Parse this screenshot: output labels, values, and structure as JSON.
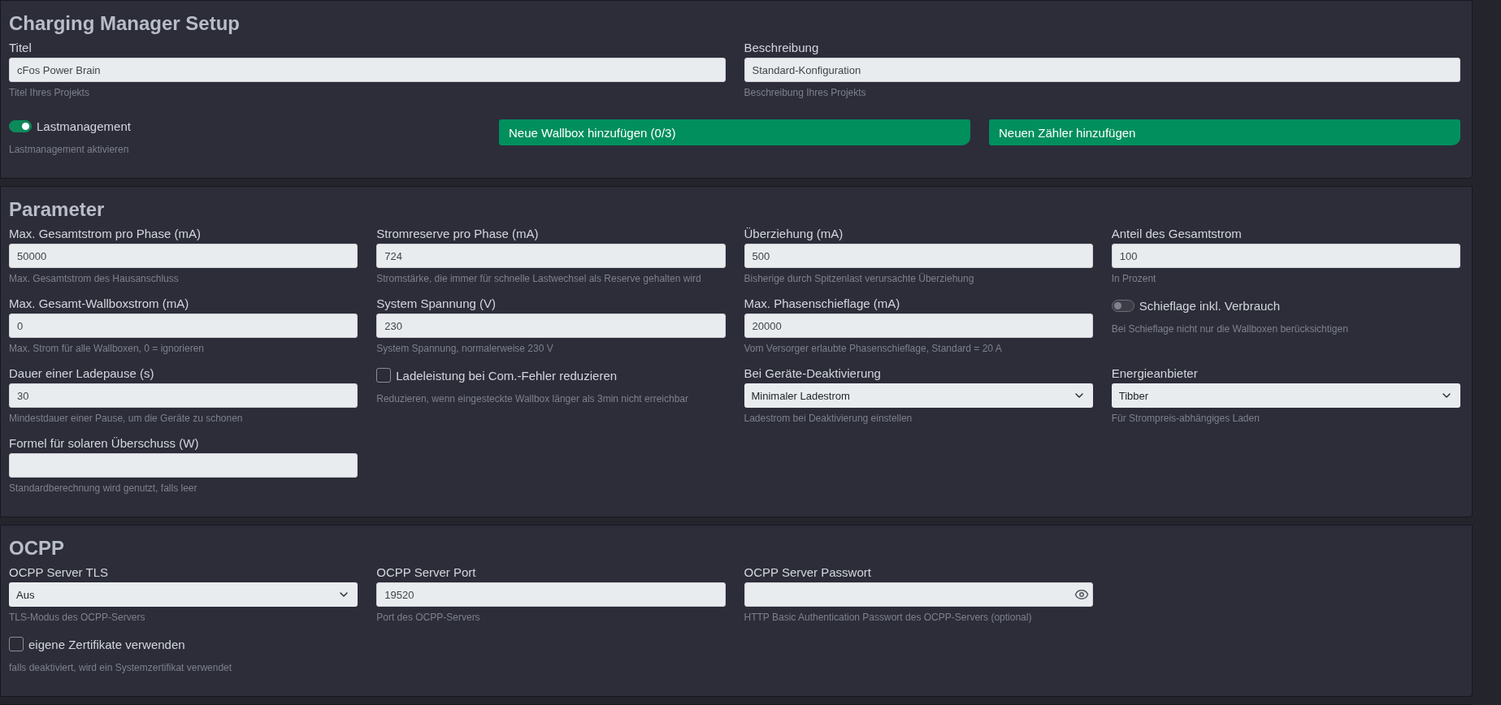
{
  "sections": [
    {
      "kind": "setup",
      "title": "Charging Manager Setup",
      "rows": [
        [
          {
            "kind": "text",
            "label": "Titel",
            "value": "cFos Power Brain",
            "help": "Titel Ihres Projekts"
          },
          {
            "kind": "text",
            "label": "Beschreibung",
            "value": "Standard-Konfiguration",
            "help": "Beschreibung Ihres Projekts"
          }
        ],
        [
          {
            "kind": "switch",
            "label": "Lastmanagement",
            "on": true,
            "help": "Lastmanagement aktivieren"
          },
          {
            "kind": "button",
            "label": "Neue Wallbox hinzufügen (0/3)"
          },
          {
            "kind": "button",
            "label": "Neuen Zähler hinzufügen"
          }
        ]
      ]
    },
    {
      "kind": "grid",
      "title": "Parameter",
      "rows": [
        [
          {
            "kind": "text",
            "label": "Max. Gesamtstrom pro Phase (mA)",
            "value": "50000",
            "help": "Max. Gesamtstrom des Hausanschluss"
          },
          {
            "kind": "text",
            "label": "Stromreserve pro Phase (mA)",
            "value": "724",
            "help": "Stromstärke, die immer für schnelle Lastwechsel als Reserve gehalten wird"
          },
          {
            "kind": "text",
            "label": "Überziehung (mA)",
            "value": "500",
            "help": "Bisherige durch Spitzenlast verursachte Überziehung"
          },
          {
            "kind": "text",
            "label": "Anteil des Gesamtstrom",
            "value": "100",
            "help": "In Prozent"
          }
        ],
        [
          {
            "kind": "text",
            "label": "Max. Gesamt-Wallboxstrom (mA)",
            "value": "0",
            "help": "Max. Strom für alle Wallboxen, 0 = ignorieren"
          },
          {
            "kind": "text",
            "label": "System Spannung (V)",
            "value": "230",
            "help": "System Spannung, normalerweise 230 V"
          },
          {
            "kind": "text",
            "label": "Max. Phasenschieflage (mA)",
            "value": "20000",
            "help": "Vom Versorger erlaubte Phasenschieflage, Standard = 20 A"
          },
          {
            "kind": "switch",
            "label": "Schieflage inkl. Verbrauch",
            "on": false,
            "help": "Bei Schieflage nicht nur die Wallboxen berücksichtigen"
          }
        ],
        [
          {
            "kind": "text",
            "label": "Dauer einer Ladepause (s)",
            "value": "30",
            "help": "Mindestdauer einer Pause, um die Geräte zu schonen"
          },
          {
            "kind": "checkbox",
            "label": "Ladeleistung bei Com.-Fehler reduzieren",
            "checked": false,
            "help": "Reduzieren, wenn eingesteckte Wallbox länger als 3min nicht erreichbar"
          },
          {
            "kind": "select",
            "label": "Bei Geräte-Deaktivierung",
            "value": "Minimaler Ladestrom",
            "help": "Ladestrom bei Deaktivierung einstellen"
          },
          {
            "kind": "select",
            "label": "Energieanbieter",
            "value": "Tibber",
            "help": "Für Strompreis-abhängiges Laden"
          }
        ],
        [
          {
            "kind": "text",
            "label": "Formel für solaren Überschuss (W)",
            "help": "Standardberechnung wird genutzt, falls leer"
          }
        ]
      ]
    },
    {
      "kind": "grid",
      "title": "OCPP",
      "rows": [
        [
          {
            "kind": "select",
            "label": "OCPP Server TLS",
            "value": "Aus",
            "help": "TLS-Modus des OCPP-Servers"
          },
          {
            "kind": "text",
            "label": "OCPP Server Port",
            "value": "19520",
            "help": "Port des OCPP-Servers"
          },
          {
            "kind": "password",
            "label": "OCPP Server Passwort",
            "help": "HTTP Basic Authentication Passwort des OCPP-Servers (optional)"
          }
        ],
        [
          {
            "kind": "checkbox",
            "label": "eigene Zertifikate verwenden",
            "checked": false,
            "help": "falls deaktiviert, wird ein Systemzertifikat verwendet"
          }
        ]
      ]
    }
  ]
}
